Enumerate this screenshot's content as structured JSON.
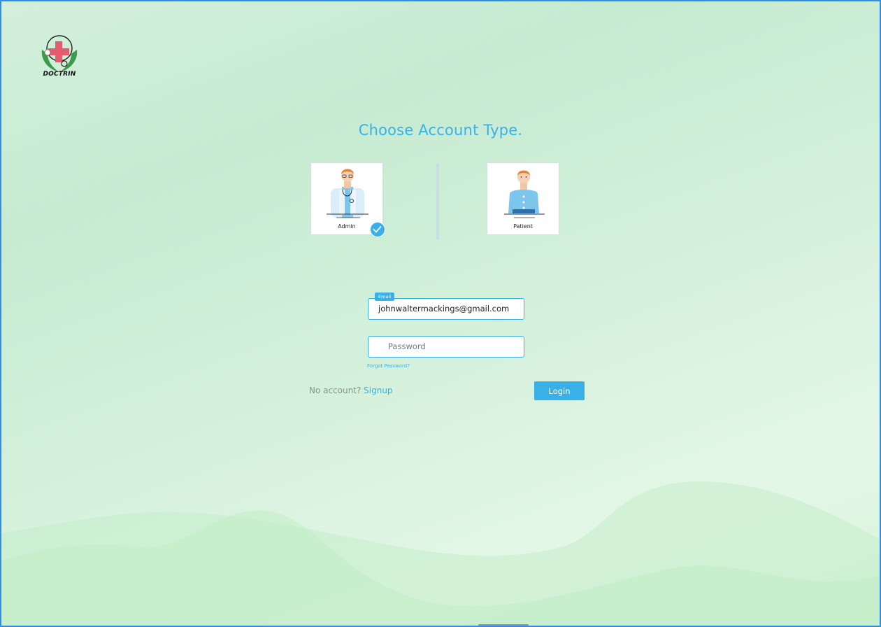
{
  "brand": {
    "name": "DOCTRIN"
  },
  "heading": "Choose Account Type.",
  "account_types": [
    {
      "label": "Admin",
      "selected": true
    },
    {
      "label": "Patient",
      "selected": false
    }
  ],
  "login_form": {
    "email": {
      "tag": "Email",
      "value": "johnwaltermackings@gmail.com"
    },
    "password": {
      "placeholder": "Password",
      "value": ""
    },
    "forgot_label": "Forgot Password?",
    "no_account_text": "No account?",
    "signup_label": "Signup",
    "login_label": "Login"
  },
  "colors": {
    "accent": "#3ab0e8",
    "frame_border": "#2f8de4",
    "logo_cross": "#e35b6c",
    "logo_hands": "#3e9a4d",
    "background": "#d3efdc"
  }
}
